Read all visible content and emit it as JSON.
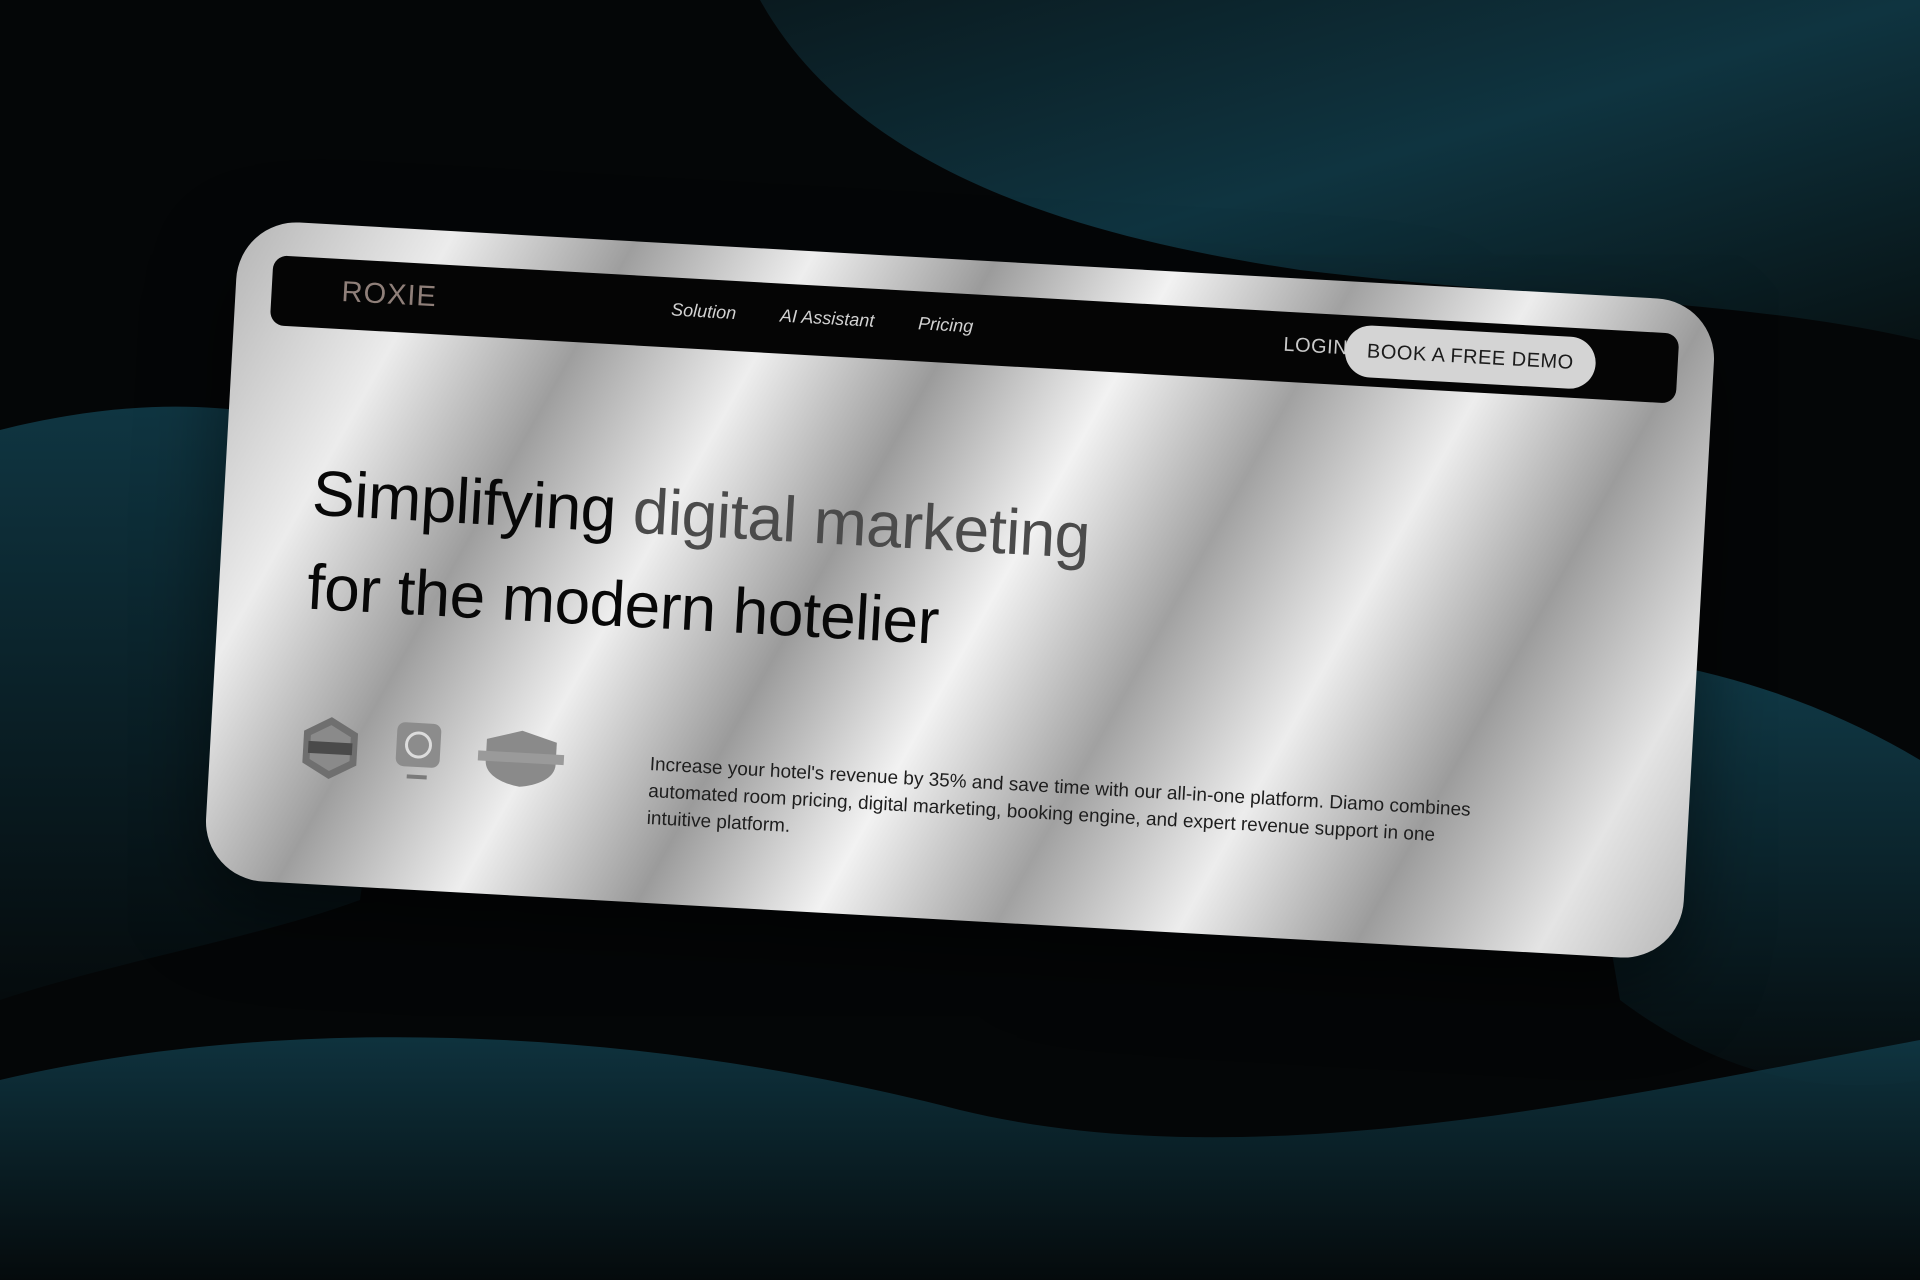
{
  "brand": {
    "logo_text": "ROXIE"
  },
  "nav": {
    "links": [
      {
        "label": "Solution"
      },
      {
        "label": "AI Assistant"
      },
      {
        "label": "Pricing"
      }
    ],
    "login_label": "LOGIN",
    "demo_label": "BOOK A FREE DEMO"
  },
  "hero": {
    "headline_part1": "Simplifying",
    "headline_part2": "digital marketing",
    "headline_line2": "for the modern hotelier",
    "description": "Increase your hotel's revenue by 35% and save time with our all-in-one platform. Diamo combines automated room pricing, digital marketing, booking engine, and expert revenue support in one intuitive platform."
  },
  "badges": [
    {
      "icon": "travel-tech-award-badge-icon"
    },
    {
      "icon": "hoteltechreport-badge-icon"
    },
    {
      "icon": "hotel-visionary-badge-icon"
    }
  ],
  "colors": {
    "background": "#040607",
    "accent_teal": "#0e3a45",
    "logo": "#8f7f79",
    "navbar": "#050505"
  }
}
